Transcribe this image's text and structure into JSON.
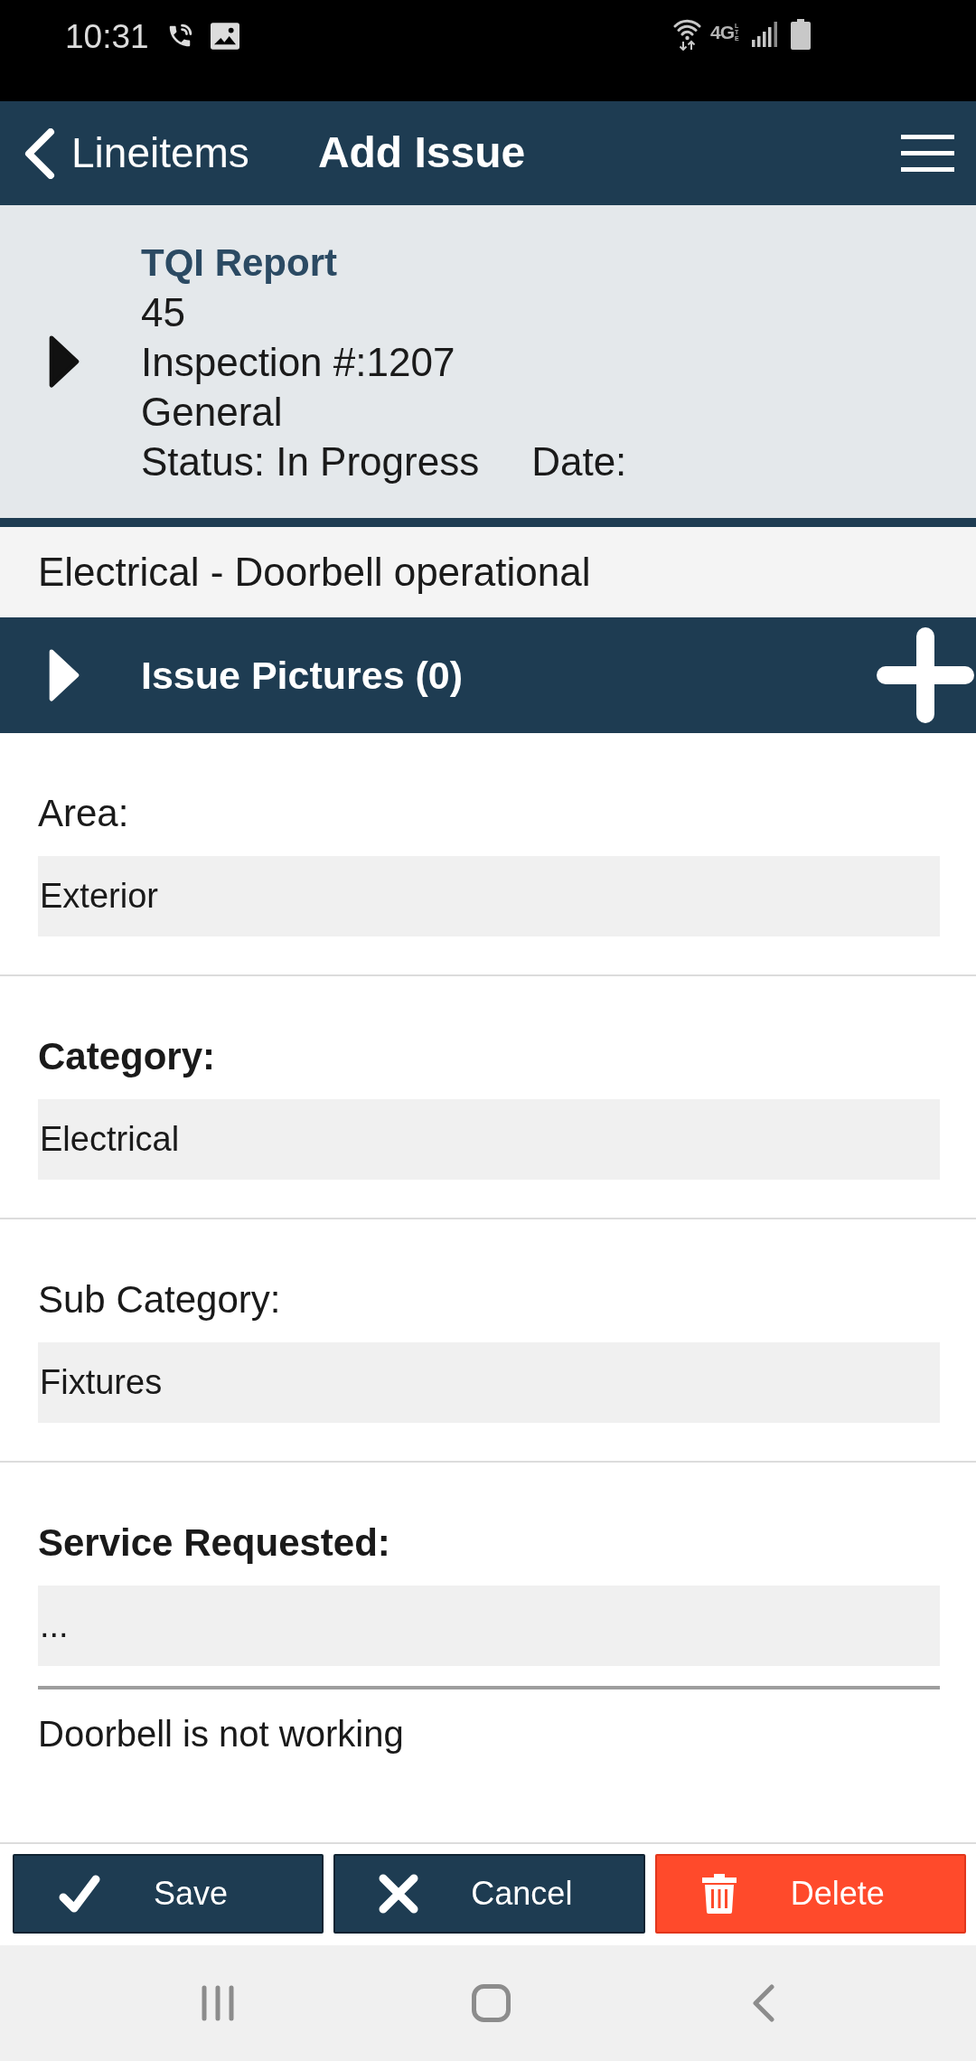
{
  "status_bar": {
    "time": "10:31",
    "network": "4G",
    "network_sub": "LTE"
  },
  "nav": {
    "back_label": "Lineitems",
    "title": "Add Issue"
  },
  "report": {
    "expanded": false,
    "title": "TQI Report",
    "lines": [
      "45",
      "Inspection #:1207",
      "General"
    ],
    "status": "Status: In Progress",
    "date": "Date:"
  },
  "item_title": "Electrical - Doorbell operational",
  "pictures_section": {
    "label": "Issue Pictures (0)",
    "expanded": false
  },
  "fields": [
    {
      "label": "Area:",
      "bold": false,
      "value": "Exterior"
    },
    {
      "label": "Category:",
      "bold": true,
      "value": "Electrical"
    },
    {
      "label": "Sub Category:",
      "bold": false,
      "value": "Fixtures"
    },
    {
      "label": "Service Requested:",
      "bold": true,
      "value": "...",
      "note": "Doorbell is not working"
    }
  ],
  "actions": [
    {
      "kind": "save",
      "label": "Save"
    },
    {
      "kind": "cancel",
      "label": "Cancel"
    },
    {
      "kind": "delete",
      "label": "Delete"
    }
  ]
}
